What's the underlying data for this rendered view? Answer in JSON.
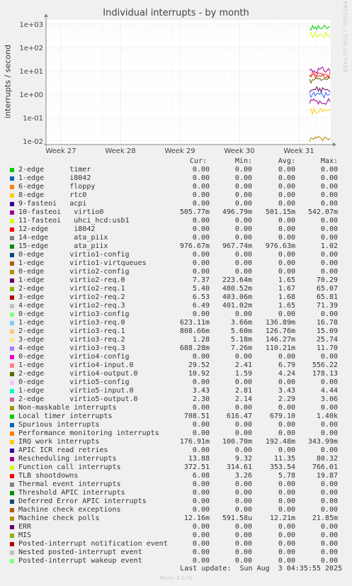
{
  "chart_data": {
    "type": "line",
    "title": "Individual interrupts - by month",
    "ylabel": "interrupts / second",
    "y_scale": "log",
    "y_ticks": [
      "1e-02",
      "1e-01",
      "1e+00",
      "1e+01",
      "1e+02",
      "1e+03"
    ],
    "y_tick_values": [
      0.01,
      0.1,
      1,
      10,
      100,
      1000
    ],
    "ylim": [
      0.007,
      1500
    ],
    "x_ticks": [
      "Week 27",
      "Week 28",
      "Week 29",
      "Week 30",
      "Week 31"
    ],
    "grid": true,
    "data_present_from": "Week 31",
    "series_shown": [
      {
        "name": "Local timer interrupts",
        "approx_value": 680,
        "color": "#00cc00"
      },
      {
        "name": "15-edge ata_piix",
        "approx_value": 0.98,
        "color": "#3366ff"
      },
      {
        "name": "Function call interrupts",
        "approx_value": 350,
        "color": "#ccff00"
      },
      {
        "name": "10-fasteoi virtio0",
        "approx_value": 0.5,
        "color": "#990099"
      },
      {
        "name": "Rescheduling interrupts",
        "approx_value": 11,
        "color": "#990099"
      },
      {
        "name": "TLB shootdowns",
        "approx_value": 5.8,
        "color": "#cc3300"
      },
      {
        "name": "1-edge virtio2-req.0",
        "approx_value": 1.65,
        "color": "#660066"
      },
      {
        "name": "1-edge virtio4-input.0",
        "approx_value": 6.8,
        "color": "#ff3333"
      },
      {
        "name": "2-edge virtio4-output.0",
        "approx_value": 4.2,
        "color": "#666600"
      },
      {
        "name": "IRQ work interrupts",
        "approx_value": 0.19,
        "color": "#ffcc00"
      },
      {
        "name": "Machine check polls",
        "approx_value": 0.012,
        "color": "#aa8800"
      }
    ]
  },
  "watermark": "RRDTOOL / TOBI OETIKER",
  "legend": {
    "headers": {
      "cur": "Cur:",
      "min": "Min:",
      "avg": "Avg:",
      "max": "Max:"
    },
    "rows": [
      {
        "label": "2-edge      timer",
        "color": "#00cc00",
        "cur": "0.00",
        "min": "0.00",
        "avg": "0.00",
        "max": "0.00"
      },
      {
        "label": "1-edge      i8042",
        "color": "#0066b3",
        "cur": "0.00",
        "min": "0.00",
        "avg": "0.00",
        "max": "0.00"
      },
      {
        "label": "6-edge      floppy",
        "color": "#ff8000",
        "cur": "0.00",
        "min": "0.00",
        "avg": "0.00",
        "max": "0.00"
      },
      {
        "label": "8-edge      rtc0",
        "color": "#ffcc00",
        "cur": "0.00",
        "min": "0.00",
        "avg": "0.00",
        "max": "0.00"
      },
      {
        "label": "9-fasteoi   acpi",
        "color": "#330099",
        "cur": "0.00",
        "min": "0.00",
        "avg": "0.00",
        "max": "0.00"
      },
      {
        "label": "10-fasteoi   virtio0",
        "color": "#990099",
        "cur": "505.77m",
        "min": "496.79m",
        "avg": "501.15m",
        "max": "542.07m"
      },
      {
        "label": "11-fasteoi   uhci_hcd:usb1",
        "color": "#ccff00",
        "cur": "0.00",
        "min": "0.00",
        "avg": "0.00",
        "max": "0.00"
      },
      {
        "label": "12-edge      i8042",
        "color": "#ff0000",
        "cur": "0.00",
        "min": "0.00",
        "avg": "0.00",
        "max": "0.00"
      },
      {
        "label": "14-edge      ata_piix",
        "color": "#808080",
        "cur": "0.00",
        "min": "0.00",
        "avg": "0.00",
        "max": "0.00"
      },
      {
        "label": "15-edge      ata_piix",
        "color": "#008f00",
        "cur": "976.67m",
        "min": "967.74m",
        "avg": "976.63m",
        "max": "1.02"
      },
      {
        "label": "0-edge      virtio1-config",
        "color": "#00487d",
        "cur": "0.00",
        "min": "0.00",
        "avg": "0.00",
        "max": "0.00"
      },
      {
        "label": "1-edge      virtio1-virtqueues",
        "color": "#b35a00",
        "cur": "0.00",
        "min": "0.00",
        "avg": "0.00",
        "max": "0.00"
      },
      {
        "label": "0-edge      virtio2-config",
        "color": "#b38f00",
        "cur": "0.00",
        "min": "0.00",
        "avg": "0.00",
        "max": "0.00"
      },
      {
        "label": "1-edge      virtio2-req.0",
        "color": "#6b006b",
        "cur": "7.37",
        "min": "223.64m",
        "avg": "1.65",
        "max": "70.29"
      },
      {
        "label": "2-edge      virtio2-req.1",
        "color": "#8fb300",
        "cur": "5.40",
        "min": "480.52m",
        "avg": "1.67",
        "max": "65.07"
      },
      {
        "label": "3-edge      virtio2-req.2",
        "color": "#b30000",
        "cur": "6.53",
        "min": "403.06m",
        "avg": "1.68",
        "max": "65.81"
      },
      {
        "label": "4-edge      virtio2-req.3",
        "color": "#bebebe",
        "cur": "6.49",
        "min": "401.02m",
        "avg": "1.65",
        "max": "71.39"
      },
      {
        "label": "0-edge      virtio3-config",
        "color": "#80ff80",
        "cur": "0.00",
        "min": "0.00",
        "avg": "0.00",
        "max": "0.00"
      },
      {
        "label": "1-edge      virtio3-req.0",
        "color": "#80c9ff",
        "cur": "623.11m",
        "min": "3.66m",
        "avg": "136.89m",
        "max": "16.78"
      },
      {
        "label": "2-edge      virtio3-req.1",
        "color": "#ffc080",
        "cur": "808.66m",
        "min": "5.60m",
        "avg": "126.76m",
        "max": "15.09"
      },
      {
        "label": "3-edge      virtio3-req.2",
        "color": "#ffe680",
        "cur": "1.28",
        "min": "5.18m",
        "avg": "146.27m",
        "max": "25.74"
      },
      {
        "label": "4-edge      virtio3-req.3",
        "color": "#aa80ff",
        "cur": "688.28m",
        "min": "7.26m",
        "avg": "110.21m",
        "max": "11.70"
      },
      {
        "label": "0-edge      virtio4-config",
        "color": "#ee00cc",
        "cur": "0.00",
        "min": "0.00",
        "avg": "0.00",
        "max": "0.00"
      },
      {
        "label": "1-edge      virtio4-input.0",
        "color": "#ff8080",
        "cur": "29.52",
        "min": "2.41",
        "avg": "6.79",
        "max": "556.22"
      },
      {
        "label": "2-edge      virtio4-output.0",
        "color": "#666600",
        "cur": "10.92",
        "min": "1.59",
        "avg": "4.24",
        "max": "178.13"
      },
      {
        "label": "0-edge      virtio5-config",
        "color": "#ffbfff",
        "cur": "0.00",
        "min": "0.00",
        "avg": "0.00",
        "max": "0.00"
      },
      {
        "label": "1-edge      virtio5-input.0",
        "color": "#00ffcc",
        "cur": "3.43",
        "min": "2.81",
        "avg": "3.43",
        "max": "4.44"
      },
      {
        "label": "2-edge      virtio5-output.0",
        "color": "#cc6699",
        "cur": "2.30",
        "min": "2.14",
        "avg": "2.29",
        "max": "3.06"
      },
      {
        "label": "Non-maskable interrupts",
        "color": "#999900",
        "cur": "0.00",
        "min": "0.00",
        "avg": "0.00",
        "max": "0.00"
      },
      {
        "label": "Local timer interrupts",
        "color": "#00cc00",
        "cur": "708.51",
        "min": "616.47",
        "avg": "679.10",
        "max": "1.40k"
      },
      {
        "label": "Spurious interrupts",
        "color": "#0066b3",
        "cur": "0.00",
        "min": "0.00",
        "avg": "0.00",
        "max": "0.00"
      },
      {
        "label": "Performance monitoring interrupts",
        "color": "#ff8000",
        "cur": "0.00",
        "min": "0.00",
        "avg": "0.00",
        "max": "0.00"
      },
      {
        "label": "IRQ work interrupts",
        "color": "#ffcc00",
        "cur": "176.91m",
        "min": "100.70m",
        "avg": "192.48m",
        "max": "343.99m"
      },
      {
        "label": "APIC ICR read retries",
        "color": "#330099",
        "cur": "0.00",
        "min": "0.00",
        "avg": "0.00",
        "max": "0.00"
      },
      {
        "label": "Rescheduling interrupts",
        "color": "#990099",
        "cur": "13.88",
        "min": "9.32",
        "avg": "11.35",
        "max": "80.32"
      },
      {
        "label": "Function call interrupts",
        "color": "#ccff00",
        "cur": "372.51",
        "min": "314.61",
        "avg": "353.54",
        "max": "766.01"
      },
      {
        "label": "TLB shootdowns",
        "color": "#ff0000",
        "cur": "6.08",
        "min": "3.26",
        "avg": "5.78",
        "max": "19.87"
      },
      {
        "label": "Thermal event interrupts",
        "color": "#808080",
        "cur": "0.00",
        "min": "0.00",
        "avg": "0.00",
        "max": "0.00"
      },
      {
        "label": "Threshold APIC interrupts",
        "color": "#008f00",
        "cur": "0.00",
        "min": "0.00",
        "avg": "0.00",
        "max": "0.00"
      },
      {
        "label": "Deferred Error APIC interrupts",
        "color": "#00487d",
        "cur": "0.00",
        "min": "0.00",
        "avg": "0.00",
        "max": "0.00"
      },
      {
        "label": "Machine check exceptions",
        "color": "#b35a00",
        "cur": "0.00",
        "min": "0.00",
        "avg": "0.00",
        "max": "0.00"
      },
      {
        "label": "Machine check polls",
        "color": "#b38f00",
        "cur": "12.16m",
        "min": "591.58u",
        "avg": "12.21m",
        "max": "21.85m"
      },
      {
        "label": "ERR",
        "color": "#6b006b",
        "cur": "0.00",
        "min": "0.00",
        "avg": "0.00",
        "max": "0.00"
      },
      {
        "label": "MIS",
        "color": "#8fb300",
        "cur": "0.00",
        "min": "0.00",
        "avg": "0.00",
        "max": "0.00"
      },
      {
        "label": "Posted-interrupt notification event",
        "color": "#b30000",
        "cur": "0.00",
        "min": "0.00",
        "avg": "0.00",
        "max": "0.00"
      },
      {
        "label": "Nested posted-interrupt event",
        "color": "#bebebe",
        "cur": "0.00",
        "min": "0.00",
        "avg": "0.00",
        "max": "0.00"
      },
      {
        "label": "Posted-interrupt wakeup event",
        "color": "#80ff80",
        "cur": "0.00",
        "min": "0.00",
        "avg": "0.00",
        "max": "0.00"
      }
    ]
  },
  "last_update": "Last update:  Sun Aug  3 04:35:55 2025",
  "version": "Munin 2.0.76"
}
